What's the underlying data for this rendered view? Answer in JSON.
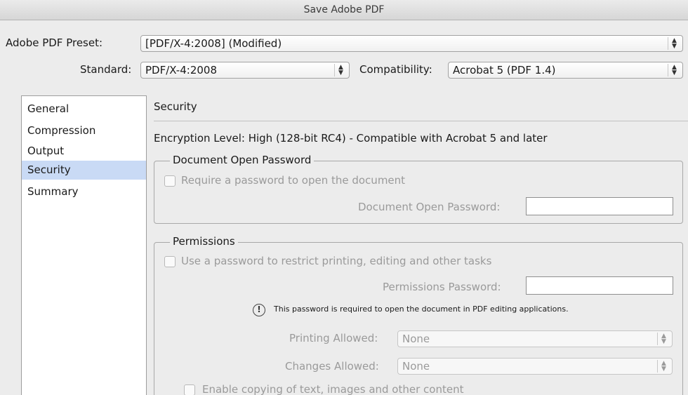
{
  "window": {
    "title": "Save Adobe PDF"
  },
  "preset": {
    "label": "Adobe PDF Preset:",
    "value": "[PDF/X-4:2008] (Modified)"
  },
  "standard": {
    "label": "Standard:",
    "value": "PDF/X-4:2008"
  },
  "compatibility": {
    "label": "Compatibility:",
    "value": "Acrobat 5 (PDF 1.4)"
  },
  "sidebar": {
    "items": [
      {
        "label": "General"
      },
      {
        "label": "Compression"
      },
      {
        "label": "Output"
      },
      {
        "label": "Security",
        "selected": true
      },
      {
        "label": "Summary"
      }
    ]
  },
  "security": {
    "title": "Security",
    "encryption_level": "Encryption Level: High (128-bit RC4) - Compatible with Acrobat 5 and later",
    "open_password": {
      "legend": "Document Open Password",
      "require_label": "Require a password to open the document",
      "field_label": "Document Open Password:",
      "value": ""
    },
    "permissions": {
      "legend": "Permissions",
      "use_label": "Use a password to restrict printing, editing and other tasks",
      "field_label": "Permissions Password:",
      "value": "",
      "note": "This password is required to open the document in PDF editing applications.",
      "printing_label": "Printing Allowed:",
      "printing_value": "None",
      "changes_label": "Changes Allowed:",
      "changes_value": "None",
      "copying_label": "Enable copying of text, images and other content"
    }
  }
}
